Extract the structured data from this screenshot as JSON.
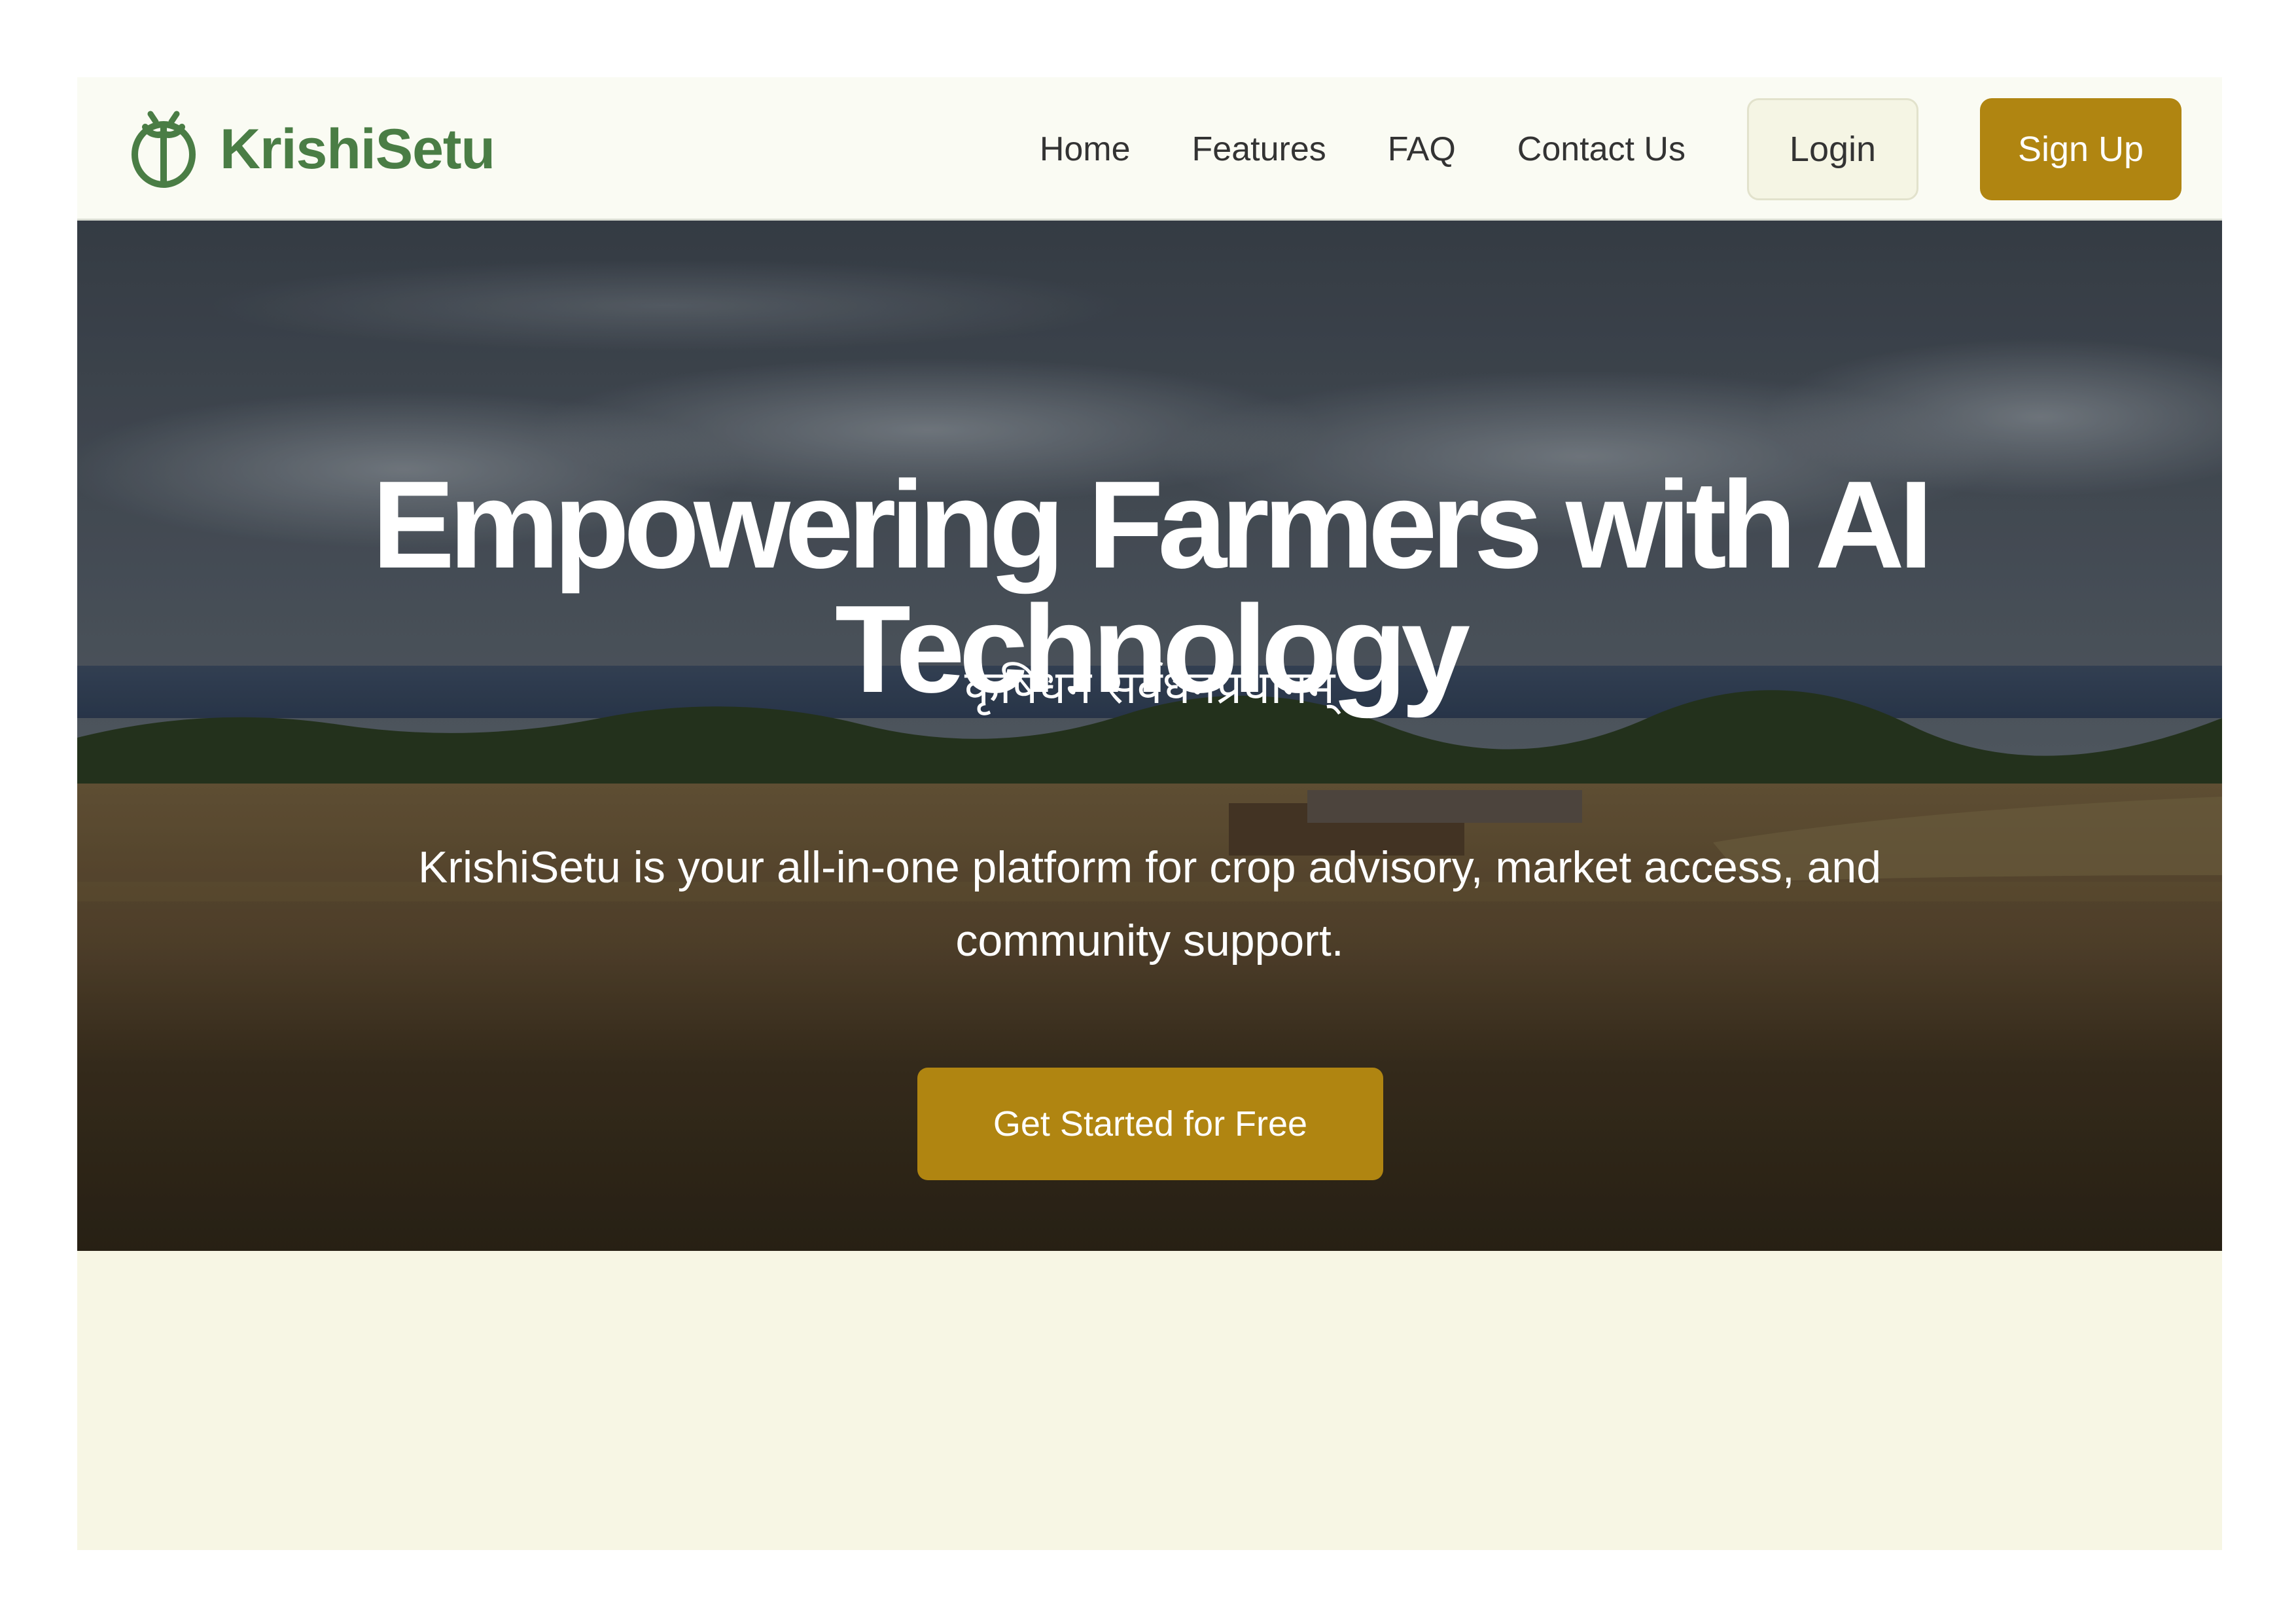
{
  "brand": {
    "name": "KrishiSetu",
    "icon": "sprout-seed-icon",
    "color": "#4a7d45"
  },
  "nav": {
    "links": [
      {
        "label": "Home"
      },
      {
        "label": "Features"
      },
      {
        "label": "FAQ"
      },
      {
        "label": "Contact Us"
      }
    ],
    "login_label": "Login",
    "signup_label": "Sign Up"
  },
  "hero": {
    "title": "Empowering Farmers with AI Technology",
    "sanskrit": "कृषिधनं सर्वधनप्रधानम्",
    "description": "KrishiSetu is your all-in-one platform for crop advisory, market access, and community support.",
    "cta_label": "Get Started for Free",
    "background": "farm-field-landscape-image"
  },
  "colors": {
    "accent": "#b08511",
    "brand_green": "#4a7d45",
    "nav_bg": "#fafbf3",
    "page_bg": "#f7f6e4",
    "login_bg": "#f5f5e4"
  }
}
